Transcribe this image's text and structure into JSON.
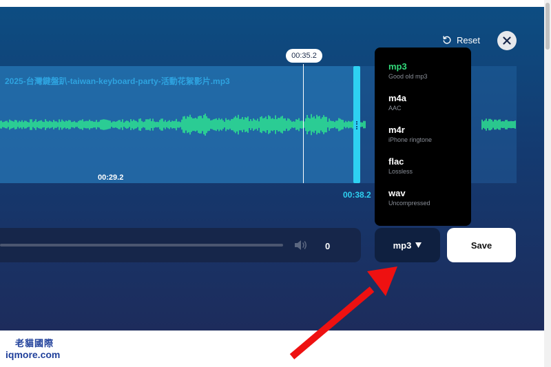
{
  "toolbar": {
    "reset_label": "Reset",
    "reset_icon": "reset-icon",
    "close_icon": "close-icon"
  },
  "editor": {
    "file_name": "2025-台灣鍵盤趴-taiwan-keyboard-party-活動花絮影片.mp3",
    "playhead_time": "00:35.2",
    "selection_start": "00:29.2",
    "selection_end": "00:38.2",
    "wave_color": "#2ee68f",
    "handle_color": "#2ed1f2"
  },
  "format_menu": {
    "selected": "mp3",
    "items": [
      {
        "name": "mp3",
        "desc": "Good old mp3"
      },
      {
        "name": "m4a",
        "desc": "AAC"
      },
      {
        "name": "m4r",
        "desc": "iPhone ringtone"
      },
      {
        "name": "flac",
        "desc": "Lossless"
      },
      {
        "name": "wav",
        "desc": "Uncompressed"
      }
    ]
  },
  "player": {
    "volume_value": "0",
    "volume_icon": "volume-icon"
  },
  "format_button": {
    "label": "mp3",
    "icon": "caret-down-icon"
  },
  "save_button": {
    "label": "Save"
  },
  "watermark": {
    "line1": "老貓國際",
    "line2": "iqmore.com"
  }
}
